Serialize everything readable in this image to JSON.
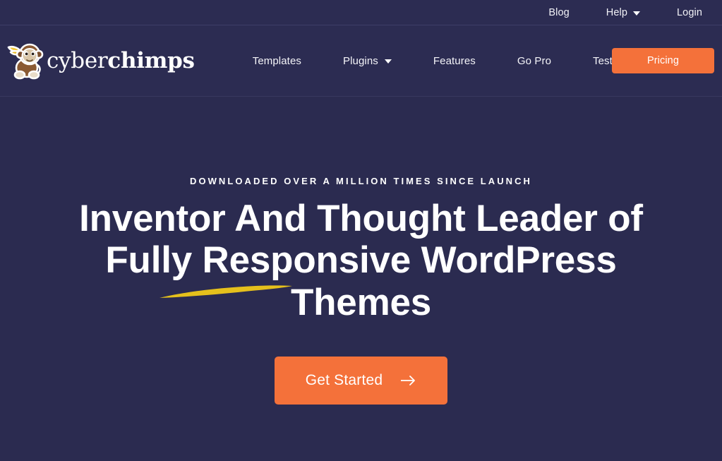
{
  "brand": {
    "name_light": "cyber",
    "name_bold": "chimps",
    "logo_icon": "chimp-mascot-icon",
    "accent_orange": "#f4713a",
    "background_navy": "#2b2b50",
    "swoosh_gold": "#e5c01c"
  },
  "topbar": {
    "links": [
      {
        "label": "Blog",
        "icon": "",
        "has_dropdown": false
      },
      {
        "label": "Help",
        "icon": "chevron-down-icon",
        "has_dropdown": true
      },
      {
        "label": "Login",
        "icon": "",
        "has_dropdown": false
      }
    ]
  },
  "header": {
    "nav": [
      {
        "label": "Templates",
        "has_dropdown": false
      },
      {
        "label": "Plugins",
        "has_dropdown": true
      },
      {
        "label": "Features",
        "has_dropdown": false
      },
      {
        "label": "Go Pro",
        "has_dropdown": false
      },
      {
        "label": "Testimonials",
        "has_dropdown": false
      }
    ],
    "pricing_label": "Pricing"
  },
  "hero": {
    "eyebrow": "Downloaded over a million times since launch",
    "headline_line1": "Inventor And Thought Leader of",
    "headline_line2": "Fully Responsive WordPress",
    "headline_line3": "Themes",
    "cta_label": "Get Started",
    "cta_icon": "arrow-right-icon"
  }
}
